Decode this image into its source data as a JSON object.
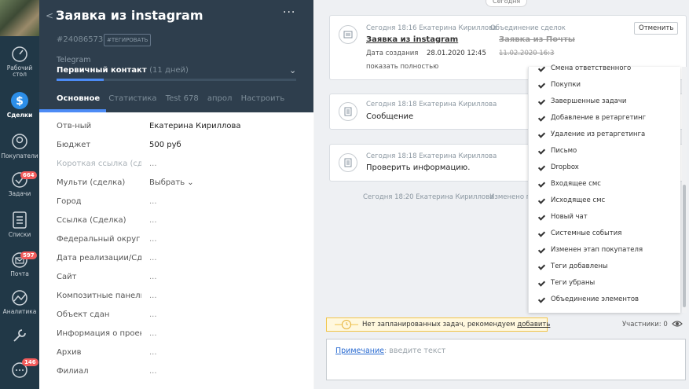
{
  "nav": {
    "items": [
      {
        "label": "Рабочий стол"
      },
      {
        "label": "Сделки"
      },
      {
        "label": "Покупатели"
      },
      {
        "label": "Задачи",
        "badge": "664"
      },
      {
        "label": "Списки"
      },
      {
        "label": "Почта",
        "badge": "597"
      },
      {
        "label": "Аналитика"
      },
      {
        "label": ""
      },
      {
        "label": "",
        "badge": "146"
      }
    ]
  },
  "card": {
    "title": "Заявка из instagram",
    "back_icon": "chevron-left-icon",
    "menu": "···",
    "lead_id": "#24086573",
    "tag_button": "#ТЕГИРОВАТЬ",
    "pipeline": "Telegram",
    "stage": "Первичный контакт",
    "stage_days": "(11 дней)",
    "tabs": [
      "Основное",
      "Статистика",
      "Test 678",
      "апрол",
      "Настроить"
    ],
    "fields": [
      {
        "label": "Отв-ный",
        "value": "Екатерина Кириллова"
      },
      {
        "label": "Бюджет",
        "value": "500 руб"
      },
      {
        "label": "Короткая ссылка (сде",
        "value": "..."
      },
      {
        "label": "Мульти (сделка)",
        "value": "Выбрать ⌄"
      },
      {
        "label": "Город",
        "value": "..."
      },
      {
        "label": "Ссылка (Сделка)",
        "value": "..."
      },
      {
        "label": "Федеральный округ",
        "value": "..."
      },
      {
        "label": "Дата реализации/Сда",
        "value": "..."
      },
      {
        "label": "Сайт",
        "value": "..."
      },
      {
        "label": "Композитные панели",
        "value": "..."
      },
      {
        "label": "Объект сдан",
        "value": "..."
      },
      {
        "label": "Информация о проек",
        "value": "..."
      },
      {
        "label": "Архив",
        "value": "..."
      },
      {
        "label": "Филиал",
        "value": "..."
      }
    ]
  },
  "feed": {
    "date_sep": "Сегодня",
    "event1": {
      "meta": "Сегодня 18:16 Екатерина Кириллова",
      "action": "Объединение сделок",
      "title": "Заявка из instagram",
      "struck_title": "Заявка из Почты",
      "created_label": "Дата создания",
      "created_date": "28.01.2020 12:45",
      "struck_date": "11.02.2020 16:3",
      "show_full": "показать полностью",
      "cancel": "Отменить"
    },
    "event2": {
      "meta": "Сегодня 18:18 Екатерина Кириллова",
      "text": "Сообщение"
    },
    "event3": {
      "meta": "Сегодня 18:18 Екатерина Кириллова",
      "text": "Проверить информацию."
    },
    "event4": {
      "meta": "Сегодня 18:20 Екатерина Кириллова",
      "text": "Изменено п"
    }
  },
  "filter": {
    "items": [
      "Смена ответственного",
      "Покупки",
      "Завершенные задачи",
      "Добавление в ретаргетинг",
      "Удаление из ретаргетинга",
      "Письмо",
      "Dropbox",
      "Входящее смс",
      "Исходящее смс",
      "Новый чат",
      "Системные события",
      "Изменен этап покупателя",
      "Теги добавлены",
      "Теги убраны",
      "Объединение элементов"
    ]
  },
  "bottom": {
    "no_tasks": "Нет запланированных задач, рекомендуем",
    "add": "добавить",
    "participants": "Участники: 0",
    "note_label": "Примечание",
    "note_placeholder": ": введите текст"
  }
}
